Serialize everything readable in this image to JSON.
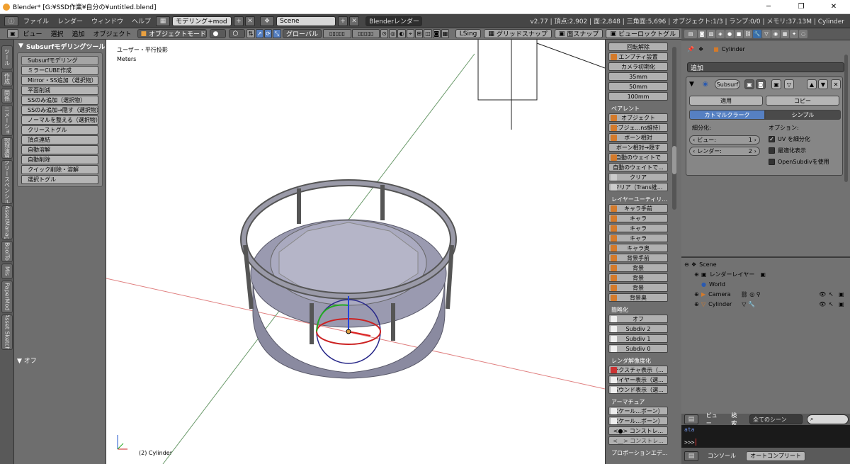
{
  "window": {
    "title": "Blender* [G:¥SSD作業¥自分の¥untitled.blend]",
    "minimize": "─",
    "maximize": "❐",
    "close": "✕"
  },
  "infobar": {
    "menus": [
      "ファイル",
      "レンダー",
      "ウィンドウ",
      "ヘルプ"
    ],
    "layout": "モデリング+mod",
    "scene": "Scene",
    "engine": "Blenderレンダー",
    "stats": "v2.77 | 頂点:2,902 | 面:2,848 | 三角面:5,696 | オブジェクト:1/3 | ランプ:0/0 | メモリ:37.13M | Cylinder"
  },
  "toolbar": {
    "menus": [
      "ビュー",
      "選択",
      "追加",
      "オブジェクト"
    ],
    "mode": "オブジェクトモード",
    "orientation": "グローバル",
    "lsing": "LSing",
    "grid_snap": "グリッドスナップ",
    "face_snap": "面スナップ",
    "view_lock": "ビューロックトグル"
  },
  "vtabs": [
    "ツール",
    "作成",
    "関係",
    "アニメーション",
    "物理演算",
    "グリースペンシル",
    "AssetManag",
    "BoolTo",
    "Mis",
    "PaperMod",
    "Asset Sketch"
  ],
  "toolshelf": {
    "header": "Subsurfモデリングツール",
    "section_label": "Subsurfモデリング",
    "buttons": [
      "ミラーCUBE作成",
      "Mirror・SS追加（選択物）",
      "平面削減",
      "SSのみ追加（選択物）",
      "SSのみ追加→隠す（選択物）",
      "ノーマルを整える（選択物）",
      "クリーストグル",
      "頂点連結",
      "自動溶解",
      "自動削除",
      "クイック削除・溶解",
      "選択トグル"
    ],
    "footer": "オフ"
  },
  "viewport": {
    "view_label": "ユーザー・平行投影",
    "units": "Meters",
    "object_label": "(2) Cylinder"
  },
  "npanel": {
    "top_buttons": [
      "回転解除",
      "エンプティ設置",
      "カメラ初期化",
      "35mm",
      "50mm",
      "100mm"
    ],
    "parent_head": "ペアレント",
    "parent_buttons": [
      "オブジェクト",
      "オブジェ...ns維持）",
      "ボーン相対",
      "ボーン相対→隠す",
      "自動のウェイトで",
      "自動のウェイトで...",
      "クリア",
      "クリア（Trans維..."
    ],
    "layer_head": "レイヤーユーティリ...",
    "layer_buttons": [
      "キャラ手前",
      "キャラ",
      "キャラ",
      "キャラ",
      "キャラ奥",
      "背景手前",
      "背景",
      "背景",
      "背景",
      "背景奥"
    ],
    "simplify_head": "簡略化",
    "simplify_buttons": [
      "オフ",
      "Subdiv 2",
      "Subdiv 1",
      "Subdiv 0"
    ],
    "render_head": "レンダ解像度化",
    "render_buttons": [
      "テクスチャ表示（...",
      "ワイヤー表示（選...",
      "バウンド表示（選..."
    ],
    "armature_head": "アーマチュア",
    "armature_buttons": [
      "スケール...ボーン）",
      "スケール...ボーン）",
      "<●> コンストレ...",
      "<__> コンストレ..."
    ],
    "proportion_head": "プロポーションエデ..."
  },
  "properties": {
    "breadcrumb": "Cylinder",
    "add_modifier": "追加",
    "modifier_name": "Subsurf",
    "apply": "適用",
    "copy": "コピー",
    "catmull": "カトマルクラーク",
    "simple": "シンプル",
    "subdivisions_label": "細分化:",
    "options_label": "オプション:",
    "view_label": "ビュー:",
    "view_value": "1",
    "render_label": "レンダー:",
    "render_value": "2",
    "uv_subdiv": "UV を細分化",
    "optimal": "最適化表示",
    "opensubdiv": "OpenSubdivを使用"
  },
  "outliner": {
    "rows": [
      {
        "label": "Scene"
      },
      {
        "label": "レンダーレイヤー"
      },
      {
        "label": "World"
      },
      {
        "label": "Camera"
      },
      {
        "label": "Cylinder"
      }
    ],
    "view": "ビュー",
    "search": "検索",
    "all_scenes": "全てのシーン"
  },
  "console": {
    "output": "ata",
    "prompt": ">>> ",
    "tab_console": "コンソール",
    "autocomplete": "オートコンプリート"
  }
}
